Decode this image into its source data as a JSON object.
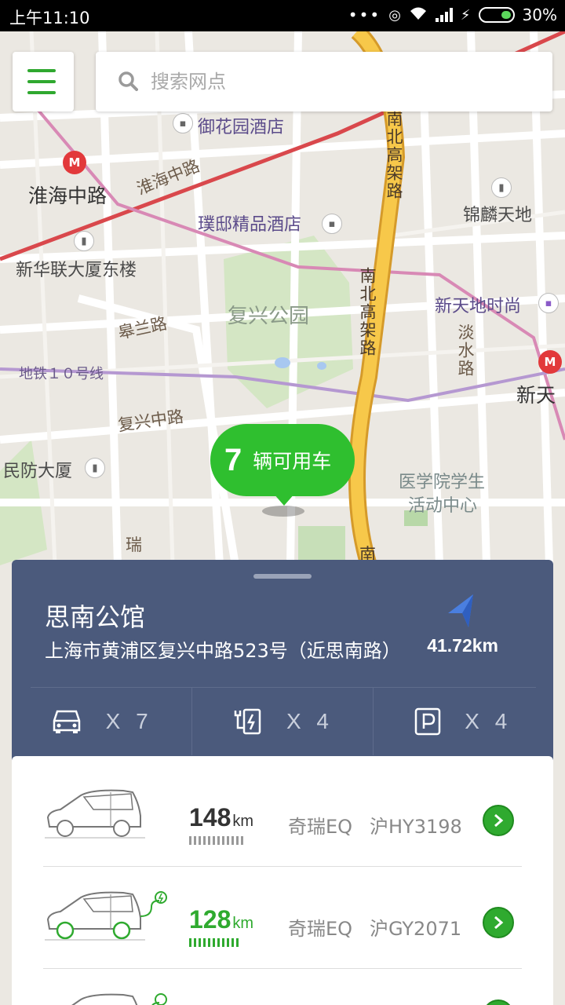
{
  "status_bar": {
    "time": "上午11:10",
    "battery": "30%"
  },
  "search": {
    "placeholder": "搜索网点"
  },
  "map_labels": {
    "yuhuayuan": "御花园酒店",
    "huaihai_road_diag": "淮海中路",
    "huaihai_road": "淮海中路",
    "puyi": "璞邸精品酒店",
    "xinhualian": "新华联大厦东楼",
    "fuxing_park": "复兴公园",
    "gaolan": "皋兰路",
    "metro10": "地铁１０号线",
    "fuxing_zhong": "复兴中路",
    "minfang": "民防大厦",
    "nanbei1": "南北高架路",
    "nanbei2": "南北高架路",
    "jinlin": "锦麟天地",
    "xintiandi_shishang": "新天地时尚",
    "danshui": "淡水路",
    "xintian": "新天",
    "yixueyuan": "医学院学生",
    "huodong": "活动中心",
    "rui": "瑞",
    "nan": "南"
  },
  "bubble": {
    "count": "7",
    "text": "辆可用车"
  },
  "station": {
    "name": "思南公馆",
    "address": "上海市黄浦区复兴中路523号（近思南路）",
    "distance": "41.72km"
  },
  "stats": {
    "cars": "X 7",
    "chargers": "X 4",
    "parking": "X 4"
  },
  "cars": [
    {
      "range": "148",
      "unit": "km",
      "model": "奇瑞EQ",
      "plate": "沪HY3198",
      "range_color": "#333333",
      "charging": false
    },
    {
      "range": "128",
      "unit": "km",
      "model": "奇瑞EQ",
      "plate": "沪GY2071",
      "range_color": "#2faa2f",
      "charging": true
    }
  ],
  "colors": {
    "accent": "#2fbf2f",
    "panel": "#4b5a7c",
    "metro_line": "#d9484c",
    "highway": "#f2b632"
  }
}
